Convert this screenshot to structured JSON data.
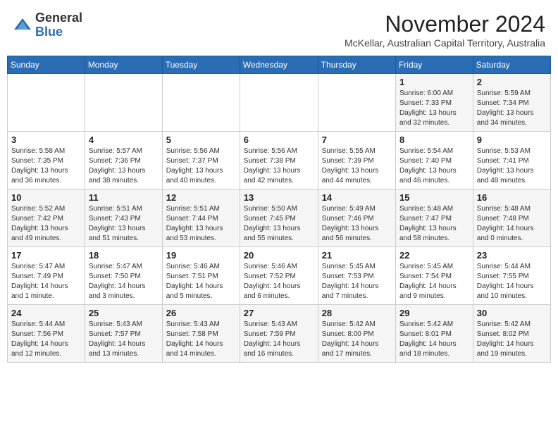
{
  "header": {
    "logo_line1": "General",
    "logo_line2": "Blue",
    "month": "November 2024",
    "location": "McKellar, Australian Capital Territory, Australia"
  },
  "weekdays": [
    "Sunday",
    "Monday",
    "Tuesday",
    "Wednesday",
    "Thursday",
    "Friday",
    "Saturday"
  ],
  "weeks": [
    [
      {
        "day": "",
        "info": ""
      },
      {
        "day": "",
        "info": ""
      },
      {
        "day": "",
        "info": ""
      },
      {
        "day": "",
        "info": ""
      },
      {
        "day": "",
        "info": ""
      },
      {
        "day": "1",
        "info": "Sunrise: 6:00 AM\nSunset: 7:33 PM\nDaylight: 13 hours\nand 32 minutes."
      },
      {
        "day": "2",
        "info": "Sunrise: 5:59 AM\nSunset: 7:34 PM\nDaylight: 13 hours\nand 34 minutes."
      }
    ],
    [
      {
        "day": "3",
        "info": "Sunrise: 5:58 AM\nSunset: 7:35 PM\nDaylight: 13 hours\nand 36 minutes."
      },
      {
        "day": "4",
        "info": "Sunrise: 5:57 AM\nSunset: 7:36 PM\nDaylight: 13 hours\nand 38 minutes."
      },
      {
        "day": "5",
        "info": "Sunrise: 5:56 AM\nSunset: 7:37 PM\nDaylight: 13 hours\nand 40 minutes."
      },
      {
        "day": "6",
        "info": "Sunrise: 5:56 AM\nSunset: 7:38 PM\nDaylight: 13 hours\nand 42 minutes."
      },
      {
        "day": "7",
        "info": "Sunrise: 5:55 AM\nSunset: 7:39 PM\nDaylight: 13 hours\nand 44 minutes."
      },
      {
        "day": "8",
        "info": "Sunrise: 5:54 AM\nSunset: 7:40 PM\nDaylight: 13 hours\nand 46 minutes."
      },
      {
        "day": "9",
        "info": "Sunrise: 5:53 AM\nSunset: 7:41 PM\nDaylight: 13 hours\nand 48 minutes."
      }
    ],
    [
      {
        "day": "10",
        "info": "Sunrise: 5:52 AM\nSunset: 7:42 PM\nDaylight: 13 hours\nand 49 minutes."
      },
      {
        "day": "11",
        "info": "Sunrise: 5:51 AM\nSunset: 7:43 PM\nDaylight: 13 hours\nand 51 minutes."
      },
      {
        "day": "12",
        "info": "Sunrise: 5:51 AM\nSunset: 7:44 PM\nDaylight: 13 hours\nand 53 minutes."
      },
      {
        "day": "13",
        "info": "Sunrise: 5:50 AM\nSunset: 7:45 PM\nDaylight: 13 hours\nand 55 minutes."
      },
      {
        "day": "14",
        "info": "Sunrise: 5:49 AM\nSunset: 7:46 PM\nDaylight: 13 hours\nand 56 minutes."
      },
      {
        "day": "15",
        "info": "Sunrise: 5:48 AM\nSunset: 7:47 PM\nDaylight: 13 hours\nand 58 minutes."
      },
      {
        "day": "16",
        "info": "Sunrise: 5:48 AM\nSunset: 7:48 PM\nDaylight: 14 hours\nand 0 minutes."
      }
    ],
    [
      {
        "day": "17",
        "info": "Sunrise: 5:47 AM\nSunset: 7:49 PM\nDaylight: 14 hours\nand 1 minute."
      },
      {
        "day": "18",
        "info": "Sunrise: 5:47 AM\nSunset: 7:50 PM\nDaylight: 14 hours\nand 3 minutes."
      },
      {
        "day": "19",
        "info": "Sunrise: 5:46 AM\nSunset: 7:51 PM\nDaylight: 14 hours\nand 5 minutes."
      },
      {
        "day": "20",
        "info": "Sunrise: 5:46 AM\nSunset: 7:52 PM\nDaylight: 14 hours\nand 6 minutes."
      },
      {
        "day": "21",
        "info": "Sunrise: 5:45 AM\nSunset: 7:53 PM\nDaylight: 14 hours\nand 7 minutes."
      },
      {
        "day": "22",
        "info": "Sunrise: 5:45 AM\nSunset: 7:54 PM\nDaylight: 14 hours\nand 9 minutes."
      },
      {
        "day": "23",
        "info": "Sunrise: 5:44 AM\nSunset: 7:55 PM\nDaylight: 14 hours\nand 10 minutes."
      }
    ],
    [
      {
        "day": "24",
        "info": "Sunrise: 5:44 AM\nSunset: 7:56 PM\nDaylight: 14 hours\nand 12 minutes."
      },
      {
        "day": "25",
        "info": "Sunrise: 5:43 AM\nSunset: 7:57 PM\nDaylight: 14 hours\nand 13 minutes."
      },
      {
        "day": "26",
        "info": "Sunrise: 5:43 AM\nSunset: 7:58 PM\nDaylight: 14 hours\nand 14 minutes."
      },
      {
        "day": "27",
        "info": "Sunrise: 5:43 AM\nSunset: 7:59 PM\nDaylight: 14 hours\nand 16 minutes."
      },
      {
        "day": "28",
        "info": "Sunrise: 5:42 AM\nSunset: 8:00 PM\nDaylight: 14 hours\nand 17 minutes."
      },
      {
        "day": "29",
        "info": "Sunrise: 5:42 AM\nSunset: 8:01 PM\nDaylight: 14 hours\nand 18 minutes."
      },
      {
        "day": "30",
        "info": "Sunrise: 5:42 AM\nSunset: 8:02 PM\nDaylight: 14 hours\nand 19 minutes."
      }
    ]
  ]
}
